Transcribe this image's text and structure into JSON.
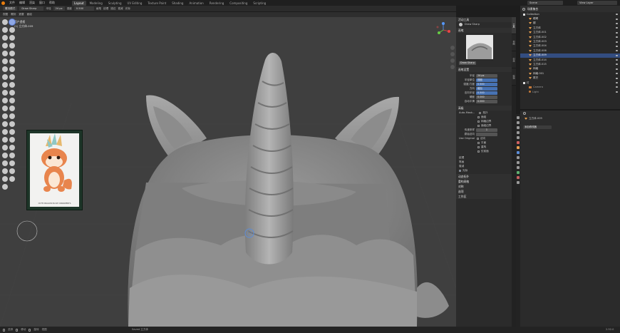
{
  "menu": [
    "文件",
    "编辑",
    "渲染",
    "窗口",
    "帮助"
  ],
  "workspaces": [
    "Layout",
    "Modeling",
    "Sculpting",
    "UV Editing",
    "Texture Paint",
    "Shading",
    "Animation",
    "Rendering",
    "Compositing",
    "Scripting"
  ],
  "active_workspace": "Layout",
  "scene": "Scene",
  "view_layer": "View Layer",
  "tool_header": {
    "tool_name": "Draw Sharp",
    "radius": "24 px",
    "strength": "0.500",
    "labels": [
      "半径",
      "强度",
      "画笔",
      "纹理",
      "描边",
      "衰减",
      "光标"
    ]
  },
  "viewport_header": {
    "mode": "雕刻模式",
    "menus": [
      "视图",
      "雕刻",
      "遮罩",
      "面组"
    ],
    "info_line1": "用户透视",
    "info_line2": "(1) 立方体.009"
  },
  "reference_image_caption": "CUTE DRAGON PLUSH ORNAMENTS",
  "tool_panel": {
    "title": "活动工具",
    "tool": "Draw Sharp",
    "brushes_title": "画笔",
    "brush_name": "Draw Sharp",
    "settings_title": "画笔设置",
    "rows": [
      {
        "label": "半径",
        "value": "24 px"
      },
      {
        "label": "半径单位",
        "value": "视图"
      },
      {
        "label": "强度/力度",
        "value": "0.500"
      },
      {
        "label": "方向",
        "value": "增加"
      },
      {
        "label": "法向半径",
        "value": "0.500"
      },
      {
        "label": "硬度",
        "value": "0.000"
      },
      {
        "label": "自动平滑",
        "value": "0.000"
      }
    ],
    "advanced_title": "高级",
    "auto_mask_label": "Auto-Mask...",
    "checkboxes": [
      "拓扑",
      "面组",
      "网格边界",
      "面组边界"
    ],
    "sample_label": "传递采样",
    "sample_value": "1",
    "original_normal_label": "原始法向",
    "original_label": "Use Original",
    "original_checks": [
      "法向",
      "平面"
    ],
    "extra_checks": [
      "重构",
      "仅前面"
    ],
    "subs": [
      "纹理",
      "笔画",
      "衰减",
      "光标"
    ],
    "sections": [
      "动态拓扑",
      "重构网格",
      "对称",
      "选项",
      "工作区"
    ]
  },
  "outliner": {
    "title": "场景集合",
    "items": [
      {
        "name": "Collection",
        "type": "collection",
        "selected": false
      },
      {
        "name": "眼睛",
        "type": "mesh",
        "selected": false
      },
      {
        "name": "腿",
        "type": "mesh",
        "selected": false
      },
      {
        "name": "立方体",
        "type": "mesh",
        "selected": false
      },
      {
        "name": "立方体.001",
        "type": "mesh",
        "selected": false
      },
      {
        "name": "立方体.002",
        "type": "mesh",
        "selected": false
      },
      {
        "name": "立方体.003",
        "type": "mesh",
        "selected": false
      },
      {
        "name": "立方体.004",
        "type": "mesh",
        "selected": false
      },
      {
        "name": "立方体.006",
        "type": "mesh",
        "selected": false
      },
      {
        "name": "立方体.009",
        "type": "mesh",
        "selected": true
      },
      {
        "name": "立方体.014",
        "type": "mesh",
        "selected": false
      },
      {
        "name": "立方体.015",
        "type": "mesh",
        "selected": false
      },
      {
        "name": "网格",
        "type": "mesh",
        "selected": false
      },
      {
        "name": "网格.001",
        "type": "mesh",
        "selected": false
      },
      {
        "name": "尾巴",
        "type": "mesh",
        "selected": false
      },
      {
        "name": "灯",
        "type": "collection",
        "selected": false
      },
      {
        "name": "Camera",
        "type": "camera",
        "selected": false
      },
      {
        "name": "Light",
        "type": "light",
        "selected": false
      }
    ]
  },
  "properties": {
    "object_name": "立方体.009",
    "section": "添加修改器"
  },
  "side_tabs": [
    "工具",
    "视图",
    "创建",
    "编辑"
  ],
  "status_bar": {
    "left": [
      "选择",
      "移动",
      "旋转",
      "视图"
    ],
    "center": "Saved 立方体",
    "version": "2.92.0"
  },
  "colors": {
    "accent": "#4772b3",
    "selected": "#334d80",
    "mesh_icon": "#e8a050",
    "vertex_icon": "#5fb0d0"
  }
}
